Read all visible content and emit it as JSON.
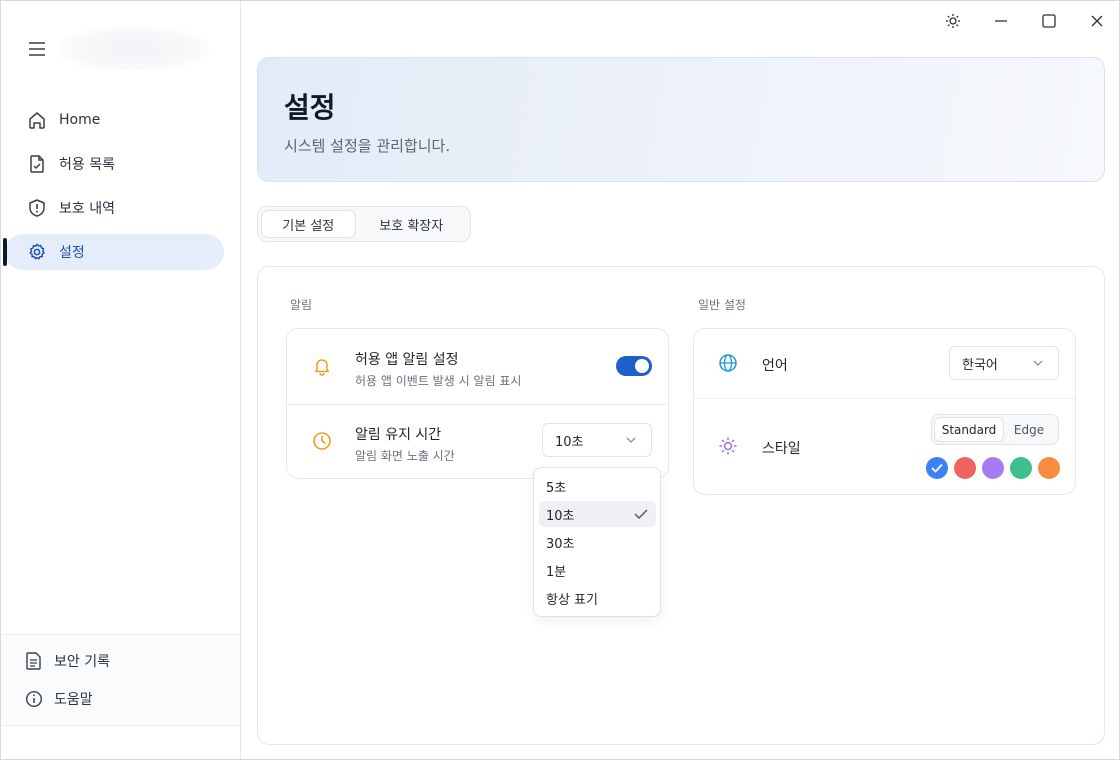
{
  "sidebar": {
    "items": [
      {
        "label": "Home",
        "icon": "home-icon"
      },
      {
        "label": "허용 목록",
        "icon": "file-check-icon"
      },
      {
        "label": "보호 내역",
        "icon": "shield-alert-icon"
      },
      {
        "label": "설정",
        "icon": "gear-icon",
        "active": true
      }
    ],
    "bottom": [
      {
        "label": "보안 기록",
        "icon": "document-icon"
      },
      {
        "label": "도움말",
        "icon": "info-icon"
      }
    ]
  },
  "titlebar": {
    "icons": [
      "brightness-icon",
      "minimize-icon",
      "maximize-icon",
      "close-icon"
    ]
  },
  "header": {
    "title": "설정",
    "subtitle": "시스템 설정을 관리합니다."
  },
  "tabs": [
    {
      "label": "기본 설정",
      "active": true
    },
    {
      "label": "보호 확장자",
      "active": false
    }
  ],
  "notifications": {
    "section_label": "알림",
    "app_alert": {
      "title": "허용 앱 알림 설정",
      "desc": "허용 앱 이벤트 발생 시 알림 표시",
      "enabled": true
    },
    "duration": {
      "title": "알림 유지 시간",
      "desc": "알림 화면 노출 시간",
      "selected": "10초",
      "options": [
        "5초",
        "10초",
        "30초",
        "1분",
        "항상 표기"
      ]
    }
  },
  "general": {
    "section_label": "일반 설정",
    "language": {
      "title": "언어",
      "selected": "한국어"
    },
    "style": {
      "title": "스타일",
      "modes": [
        "Standard",
        "Edge"
      ],
      "active_mode": "Standard",
      "colors": [
        "#3b82f6",
        "#ef6461",
        "#a67cf5",
        "#3ebf8e",
        "#f98c3f"
      ],
      "selected_color": "#3b82f6"
    }
  },
  "colors": {
    "accent": "#1f5fcc",
    "icon_orange": "#f29d1f",
    "icon_blue": "#1d9bd8",
    "icon_purple": "#9b6be6"
  }
}
